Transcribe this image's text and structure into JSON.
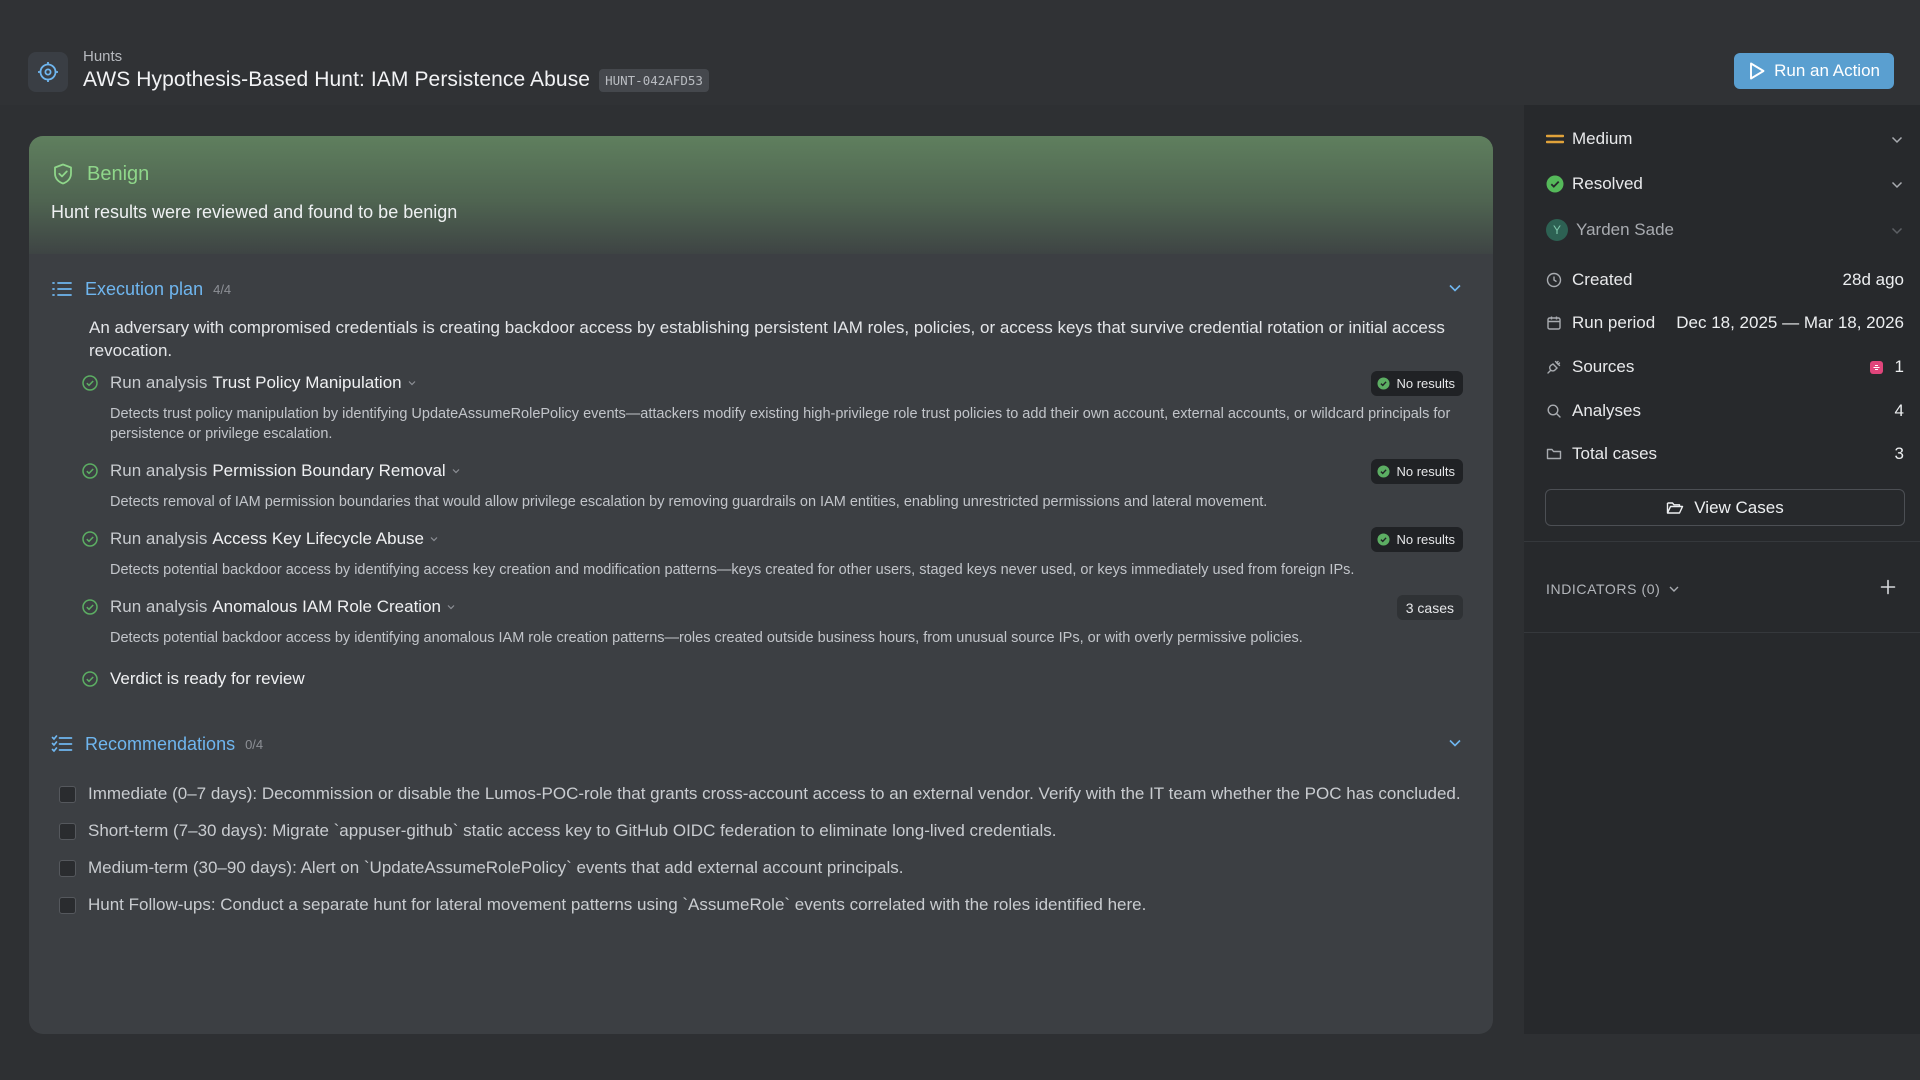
{
  "header": {
    "breadcrumb": "Hunts",
    "title": "AWS Hypothesis-Based Hunt: IAM Persistence Abuse",
    "hunt_id": "HUNT-042AFD53",
    "run_action_label": "Run an Action",
    "logo_icon": "crosshair-icon"
  },
  "verdict": {
    "label": "Benign",
    "text": "Hunt results were reviewed and found to be benign",
    "color": "#8fd68a"
  },
  "execution_plan": {
    "title": "Execution plan",
    "count": "4/4",
    "description": "An adversary with compromised credentials is creating backdoor access by establishing persistent IAM roles, policies, or access keys that survive credential rotation or initial access revocation.",
    "steps": [
      {
        "prefix": "Run analysis",
        "name": "Trust Policy Manipulation",
        "badge": "No results",
        "description": "Detects trust policy manipulation by identifying UpdateAssumeRolePolicy events—attackers modify existing high-privilege role trust policies to add their own account, external accounts, or wildcard principals for persistence or privilege escalation."
      },
      {
        "prefix": "Run analysis",
        "name": "Permission Boundary Removal",
        "badge": "No results",
        "description": "Detects removal of IAM permission boundaries that would allow privilege escalation by removing guardrails on IAM entities, enabling unrestricted permissions and lateral movement."
      },
      {
        "prefix": "Run analysis",
        "name": "Access Key Lifecycle Abuse",
        "badge": "No results",
        "description": "Detects potential backdoor access by identifying access key creation and modification patterns—keys created for other users, staged keys never used, or keys immediately used from foreign IPs."
      },
      {
        "prefix": "Run analysis",
        "name": "Anomalous IAM Role Creation",
        "badge": "3 cases",
        "description": "Detects potential backdoor access by identifying anomalous IAM role creation patterns—roles created outside business hours, from unusual source IPs, or with overly permissive policies."
      }
    ],
    "final_step": "Verdict is ready for review"
  },
  "recommendations": {
    "title": "Recommendations",
    "count": "0/4",
    "items": [
      "Immediate (0–7 days): Decommission or disable the Lumos-POC-role that grants cross-account access to an external vendor. Verify with the IT team whether the POC has concluded.",
      "Short-term (7–30 days): Migrate `appuser-github` static access key to GitHub OIDC federation to eliminate long-lived credentials.",
      "Medium-term (30–90 days): Alert on `UpdateAssumeRolePolicy` events that add external account principals.",
      "Hunt Follow-ups: Conduct a separate hunt for lateral movement patterns using `AssumeRole` events correlated with the roles identified here."
    ]
  },
  "sidebar": {
    "severity": "Medium",
    "severity_color": "#e0a23a",
    "status": "Resolved",
    "status_color": "#55b95a",
    "assignee": "Yarden Sade",
    "assignee_initial": "Y",
    "created_label": "Created",
    "created_value": "28d ago",
    "run_period_label": "Run period",
    "run_period_value": "Dec 18, 2025 — Mar 18, 2026",
    "sources_label": "Sources",
    "sources_value": "1",
    "analyses_label": "Analyses",
    "analyses_value": "4",
    "total_cases_label": "Total cases",
    "total_cases_value": "3",
    "view_cases_label": "View Cases",
    "indicators_label": "INDICATORS (0)"
  }
}
